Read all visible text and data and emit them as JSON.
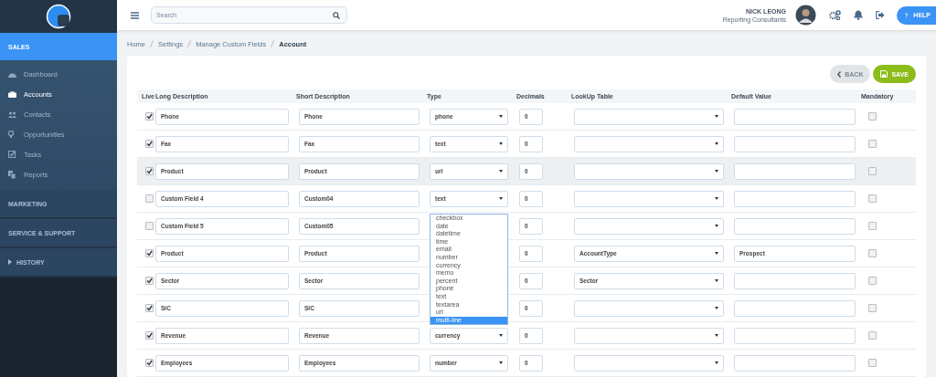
{
  "sidebar": {
    "sections": [
      {
        "title": "SALES",
        "kind": "plain",
        "expanded": true,
        "items": [
          {
            "label": "Dashboard",
            "selected": false
          },
          {
            "label": "Accounts",
            "selected": true
          },
          {
            "label": "Contacts",
            "selected": false
          },
          {
            "label": "Opportunities",
            "selected": false
          },
          {
            "label": "Tasks",
            "selected": false
          },
          {
            "label": "Reports",
            "selected": false
          }
        ]
      },
      {
        "title": "MARKETING",
        "kind": "plain",
        "expanded": false
      },
      {
        "title": "SERVICE & SUPPORT",
        "kind": "plain",
        "expanded": false
      },
      {
        "title": "HISTORY",
        "kind": "caret",
        "expanded": false
      }
    ]
  },
  "topbar": {
    "search": {
      "placeholder": "Search"
    },
    "user": {
      "name": "NICK LEONG",
      "company": "Reporting Consultants"
    },
    "help_button": "HELP"
  },
  "breadcrumb": [
    "Home",
    "Settings",
    "Manage Custom Fields",
    "Account"
  ],
  "buttons": {
    "back": "BACK",
    "save": "SAVE"
  },
  "table": {
    "columns": [
      "Live",
      "Long Description",
      "Short Description",
      "Type",
      "Decimals",
      "LookUp Table",
      "Default Value",
      "Mandatory"
    ],
    "rows": [
      {
        "live": true,
        "long": "Phone",
        "short": "Phone",
        "type": "phone",
        "decimals": "0",
        "mandatory": false,
        "selected": false
      },
      {
        "live": true,
        "long": "Fax",
        "short": "Fax",
        "type": "text",
        "decimals": "0",
        "mandatory": false,
        "selected": false
      },
      {
        "live": true,
        "long": "Product",
        "short": "Product",
        "type": "url",
        "decimals": "0",
        "mandatory": false,
        "selected": true
      },
      {
        "live": false,
        "long": "Custom Field 4",
        "short": "Custom04",
        "type": "text",
        "decimals": "0",
        "mandatory": false,
        "selected": false
      },
      {
        "live": false,
        "long": "Custom Field 5",
        "short": "Custom05",
        "decimals": "0",
        "mandatory": false,
        "selected": false,
        "dropdown_open": true
      },
      {
        "live": true,
        "long": "Product",
        "short": "Product",
        "decimals": "0",
        "lookup": "AccountType",
        "default": "Prospect",
        "mandatory": false,
        "selected": false
      },
      {
        "live": true,
        "long": "Sector",
        "short": "Sector",
        "decimals": "0",
        "lookup": "Sector",
        "mandatory": false,
        "selected": false
      },
      {
        "live": true,
        "long": "SIC",
        "short": "SIC",
        "decimals": "0",
        "mandatory": false,
        "selected": false
      },
      {
        "live": true,
        "long": "Revenue",
        "short": "Revenue",
        "type": "currency",
        "decimals": "0",
        "mandatory": false,
        "selected": false
      },
      {
        "live": true,
        "long": "Employees",
        "short": "Employees",
        "type": "number",
        "decimals": "0",
        "mandatory": false,
        "selected": false
      }
    ],
    "type_dropdown": {
      "options": [
        {
          "label": "checkbox",
          "selected": false
        },
        {
          "label": "date",
          "selected": false
        },
        {
          "label": "datetime",
          "selected": false
        },
        {
          "label": "time",
          "selected": false
        },
        {
          "label": "email",
          "selected": false
        },
        {
          "label": "number",
          "selected": false
        },
        {
          "label": "currency",
          "selected": false
        },
        {
          "label": "memo",
          "selected": false
        },
        {
          "label": "percent",
          "selected": false
        },
        {
          "label": "phone",
          "selected": false
        },
        {
          "label": "text",
          "selected": false
        },
        {
          "label": "textarea",
          "selected": false
        },
        {
          "label": "url",
          "selected": false
        },
        {
          "label": "multi-line",
          "selected": true
        }
      ]
    }
  }
}
